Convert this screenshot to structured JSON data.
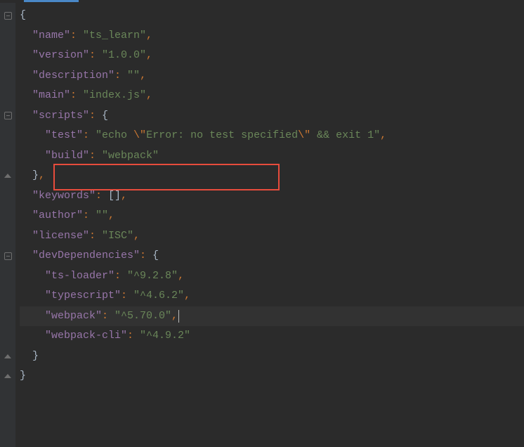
{
  "json": {
    "name_key": "\"name\"",
    "name_val": "\"ts_learn\"",
    "version_key": "\"version\"",
    "version_val": "\"1.0.0\"",
    "description_key": "\"description\"",
    "description_val": "\"\"",
    "main_key": "\"main\"",
    "main_val": "\"index.js\"",
    "scripts_key": "\"scripts\"",
    "scripts": {
      "test_key": "\"test\"",
      "test_val_open": "\"echo ",
      "test_esc1": "\\\"",
      "test_mid": "Error: no test specified",
      "test_esc2": "\\\"",
      "test_val_close": " && exit 1\"",
      "build_key": "\"build\"",
      "build_val": "\"webpack\""
    },
    "keywords_key": "\"keywords\"",
    "keywords_val": "[]",
    "author_key": "\"author\"",
    "author_val": "\"\"",
    "license_key": "\"license\"",
    "license_val": "\"ISC\"",
    "devdeps_key": "\"devDependencies\"",
    "devdeps": {
      "tsloader_key": "\"ts-loader\"",
      "tsloader_val": "\"^9.2.8\"",
      "typescript_key": "\"typescript\"",
      "typescript_val": "\"^4.6.2\"",
      "webpack_key": "\"webpack\"",
      "webpack_val": "\"^5.70.0\"",
      "webpackcli_key": "\"webpack-cli\"",
      "webpackcli_val": "\"^4.9.2\""
    }
  },
  "sym": {
    "open_brace": "{",
    "close_brace": "}",
    "colon_sp": ": ",
    "comma": ","
  }
}
